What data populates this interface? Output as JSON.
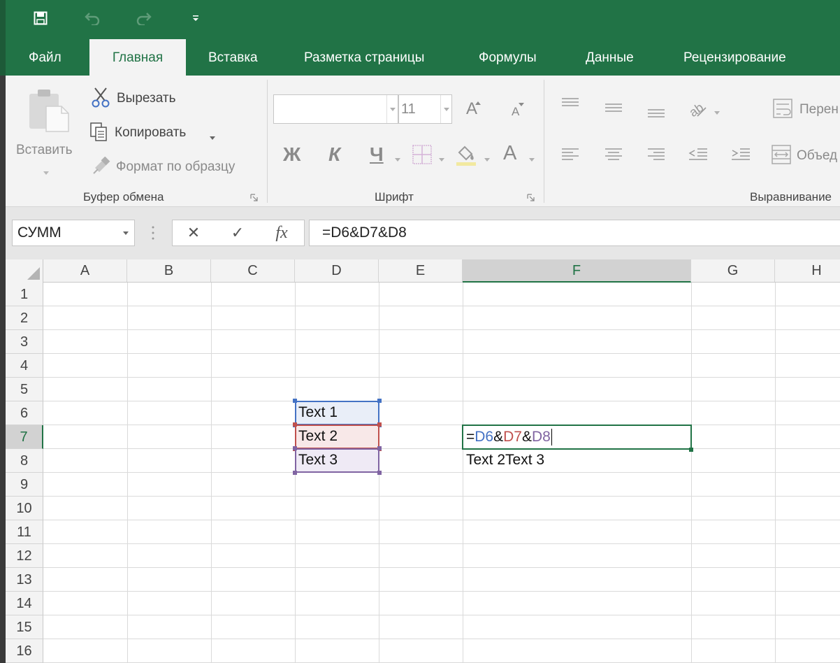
{
  "colors": {
    "brand": "#217346",
    "ref1": "#4472c4",
    "ref2": "#c0504d",
    "ref3": "#8064a2"
  },
  "qat": {
    "save_icon": "save-icon",
    "undo_icon": "undo-icon",
    "redo_icon": "redo-icon",
    "customize_icon": "customize-qat-icon"
  },
  "tabs": [
    {
      "label": "Файл"
    },
    {
      "label": "Главная"
    },
    {
      "label": "Вставка"
    },
    {
      "label": "Разметка страницы"
    },
    {
      "label": "Формулы"
    },
    {
      "label": "Данные"
    },
    {
      "label": "Рецензирование"
    }
  ],
  "ribbon": {
    "clipboard": {
      "paste_label": "Вставить",
      "cut_label": "Вырезать",
      "copy_label": "Копировать",
      "format_painter_label": "Формат по образцу",
      "group_label": "Буфер обмена"
    },
    "font": {
      "font_name": "",
      "font_size": "11",
      "increase_label": "A",
      "decrease_label": "A",
      "bold_label": "Ж",
      "italic_label": "К",
      "underline_label": "Ч",
      "font_color_label": "A",
      "group_label": "Шрифт"
    },
    "alignment": {
      "wrap_label": "Перен",
      "merge_label": "Объед",
      "group_label": "Выравнивание"
    }
  },
  "formula_bar": {
    "name_box": "СУММ",
    "cancel": "✕",
    "enter": "✓",
    "fx": "fx",
    "formula": "=D6&D7&D8"
  },
  "columns": [
    "A",
    "B",
    "C",
    "D",
    "E",
    "F",
    "G",
    "H"
  ],
  "rows": [
    "1",
    "2",
    "3",
    "4",
    "5",
    "6",
    "7",
    "8",
    "9",
    "10",
    "11",
    "12",
    "13",
    "14",
    "15",
    "16"
  ],
  "cells": {
    "D6": "Text 1",
    "D7": "Text 2",
    "D8": "Text 3",
    "F8": "Text 2Text 3"
  },
  "edit_cell": {
    "tokens": [
      {
        "text": "=",
        "color": "#111111"
      },
      {
        "text": "D6",
        "color": "#4472c4"
      },
      {
        "text": "&",
        "color": "#111111"
      },
      {
        "text": "D7",
        "color": "#c0504d"
      },
      {
        "text": "&",
        "color": "#111111"
      },
      {
        "text": "D8",
        "color": "#8064a2"
      }
    ]
  }
}
